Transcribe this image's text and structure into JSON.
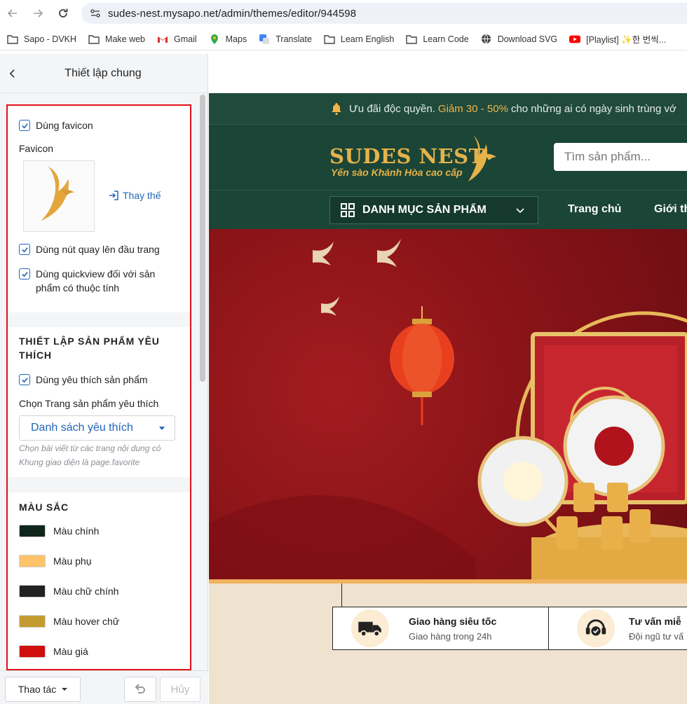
{
  "browser": {
    "url": "sudes-nest.mysapo.net/admin/themes/editor/944598",
    "bookmarks": [
      {
        "label": "Sapo - DVKH",
        "icon": "folder-icon"
      },
      {
        "label": "Make web",
        "icon": "folder-icon"
      },
      {
        "label": "Gmail",
        "icon": "gmail-icon"
      },
      {
        "label": "Maps",
        "icon": "maps-icon"
      },
      {
        "label": "Translate",
        "icon": "translate-icon"
      },
      {
        "label": "Learn English",
        "icon": "folder-icon"
      },
      {
        "label": "Learn Code",
        "icon": "folder-icon"
      },
      {
        "label": "Download SVG",
        "icon": "globe-icon"
      },
      {
        "label": "[Playlist] ✨한 번씩...",
        "icon": "youtube-icon"
      }
    ]
  },
  "panel": {
    "title": "Thiết lập chung",
    "general": {
      "use_favicon": "Dùng favicon",
      "favicon_label": "Favicon",
      "replace_label": "Thay thế",
      "back_to_top": "Dùng nút quay lên đầu trang",
      "quickview": "Dùng quickview đối với sản phẩm có thuộc tính"
    },
    "wishlist": {
      "title": "THIẾT LẬP SẢN PHẨM YÊU THÍCH",
      "enable": "Dùng yêu thích sản phẩm",
      "page_label": "Chọn Trang sản phẩm yêu thích",
      "selected_page": "Danh sách yêu thích",
      "hint": "Chọn bài viết từ các trang nội dung có Khung giao diện là page.favorite"
    },
    "colors": {
      "title": "MÀU SẮC",
      "items": [
        {
          "label": "Màu chính",
          "color": "#10261d"
        },
        {
          "label": "Màu phụ",
          "color": "#ffc36a"
        },
        {
          "label": "Màu chữ chính",
          "color": "#222222"
        },
        {
          "label": "Màu hover chữ",
          "color": "#c49b2e"
        },
        {
          "label": "Màu giá",
          "color": "#d00e0e"
        }
      ]
    },
    "footer": {
      "actions": "Thao tác",
      "cancel": "Hủy"
    }
  },
  "preview": {
    "promo_prefix": "Ưu đãi độc quyền.",
    "promo_highlight": "Giảm 30 - 50%",
    "promo_suffix": "cho những ai có ngày sinh trùng vớ",
    "logo_name": "SUDES NEST",
    "logo_tagline": "Yến sào Khánh Hòa cao cấp",
    "search_placeholder": "Tìm sản phẩm...",
    "category_button": "DANH MỤC SẢN PHẨM",
    "menu": [
      "Trang chủ",
      "Giới th"
    ],
    "features": [
      {
        "title": "Giao hàng siêu tốc",
        "subtitle": "Giao hàng trong 24h"
      },
      {
        "title": "Tư vấn miễ",
        "subtitle": "Đội ngũ tư vấ"
      }
    ]
  }
}
